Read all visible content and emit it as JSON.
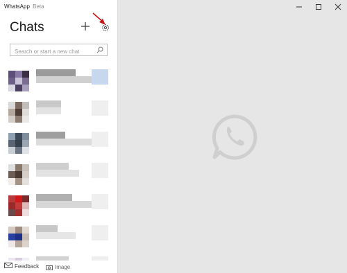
{
  "window": {
    "app_name": "WhatsApp",
    "badge": "Beta"
  },
  "sidebar": {
    "title": "Chats",
    "search": {
      "placeholder": "Search or start a new chat"
    },
    "new_chat_icon": "plus-icon",
    "settings_icon": "gear-icon",
    "chats": [
      {
        "status": "blurred"
      },
      {
        "status": "blurred"
      },
      {
        "status": "blurred"
      },
      {
        "status": "blurred"
      },
      {
        "status": "blurred"
      },
      {
        "status": "blurred"
      },
      {
        "status": "blurred"
      }
    ]
  },
  "footer": {
    "feedback": "Feedback",
    "image": "Image"
  },
  "colors": {
    "panel_bg": "#e6e6e6",
    "logo_gray": "#cfcfcf",
    "annotation_arrow": "#cc1010"
  }
}
